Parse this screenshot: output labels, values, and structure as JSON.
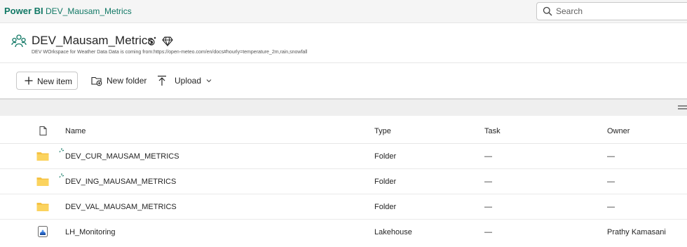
{
  "app": {
    "brand": "Power BI",
    "breadcrumb": "DEV_Mausam_Metrics"
  },
  "search": {
    "placeholder": "Search"
  },
  "workspace": {
    "title": "DEV_Mausam_Metrics",
    "description": "DEV WOrkspace for Weather Data Data is coming from:https://open-meteo.com/en/docs#hourly=temperature_2m,rain,snowfall"
  },
  "toolbar": {
    "new_item": "New item",
    "new_folder": "New folder",
    "upload": "Upload"
  },
  "table": {
    "columns": {
      "name": "Name",
      "type": "Type",
      "task": "Task",
      "owner": "Owner"
    },
    "rows": [
      {
        "name": "DEV_CUR_MAUSAM_METRICS",
        "type": "Folder",
        "task": "—",
        "owner": "—",
        "icon": "folder-icon"
      },
      {
        "name": "DEV_ING_MAUSAM_METRICS",
        "type": "Folder",
        "task": "—",
        "owner": "—",
        "icon": "folder-icon"
      },
      {
        "name": "DEV_VAL_MAUSAM_METRICS",
        "type": "Folder",
        "task": "—",
        "owner": "—",
        "icon": "folder-icon"
      },
      {
        "name": "LH_Monitoring",
        "type": "Lakehouse",
        "task": "—",
        "owner": "Prathy Kamasani",
        "icon": "lakehouse-icon"
      }
    ]
  },
  "colors": {
    "brand": "#117865",
    "folder": "#f5c242"
  }
}
